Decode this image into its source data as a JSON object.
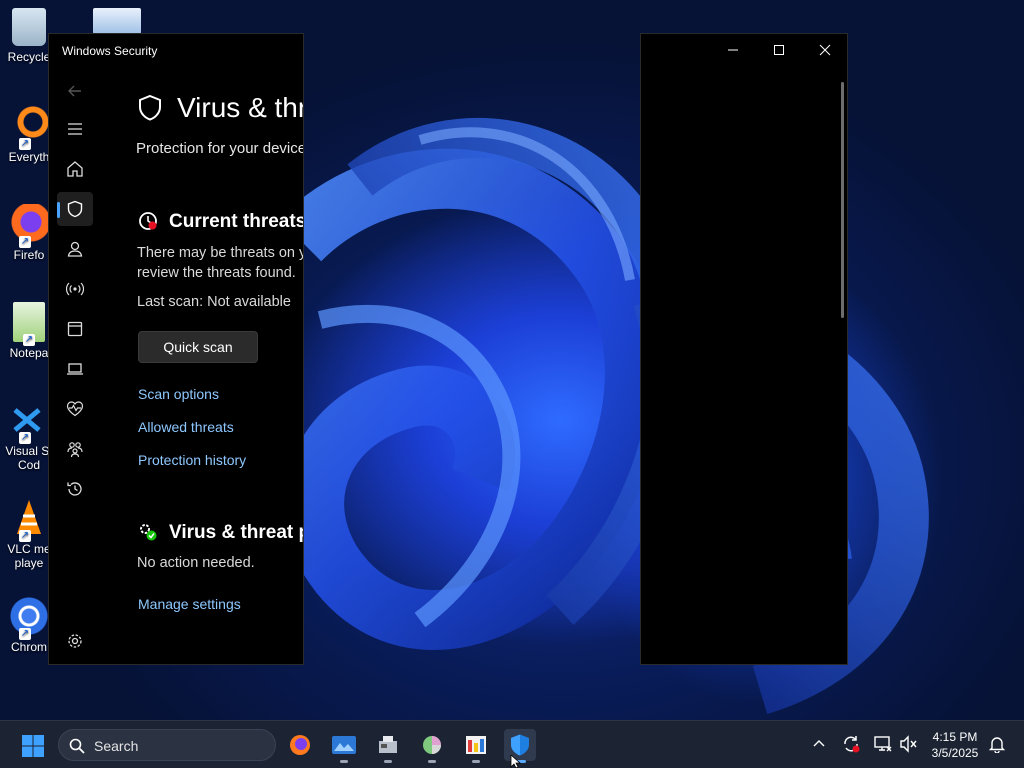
{
  "desktop": {
    "icons": [
      {
        "label": "Recycle",
        "icon": "recycle-bin-icon"
      },
      {
        "label": "Everyth",
        "icon": "everything-search-icon"
      },
      {
        "label": "Firefo",
        "icon": "firefox-icon"
      },
      {
        "label": "Notepa",
        "icon": "notepad-icon"
      },
      {
        "label": "Visual St",
        "label2": "Cod",
        "icon": "vscode-icon"
      },
      {
        "label": "VLC me",
        "label2": "playe",
        "icon": "vlc-icon"
      },
      {
        "label": "Chrom",
        "icon": "chrome-icon"
      }
    ]
  },
  "security_window": {
    "title": "Windows Security",
    "page_title": "Virus & thre",
    "subtitle": "Protection for your device",
    "current_threats": {
      "heading": "Current threats",
      "line1": "There may be threats on y",
      "line2": "review the threats found.",
      "last_scan": "Last scan: Not available",
      "quick_scan": "Quick scan",
      "links": [
        "Scan options",
        "Allowed threats",
        "Protection history"
      ]
    },
    "protection_settings": {
      "heading": "Virus & threat p",
      "status": "No action needed.",
      "manage": "Manage settings"
    },
    "nav_icons": [
      "back-arrow-icon",
      "hamburger-menu-icon",
      "home-icon",
      "shield-icon",
      "account-icon",
      "network-icon",
      "app-browser-icon",
      "device-security-icon",
      "health-icon",
      "family-icon",
      "history-icon",
      "settings-icon"
    ]
  },
  "taskbar": {
    "search_placeholder": "Search",
    "time": "4:15 PM",
    "date": "3/5/2025"
  },
  "colors": {
    "accent": "#4aa3ff",
    "link": "#8ec8ff",
    "taskbar": "#1c2433"
  }
}
